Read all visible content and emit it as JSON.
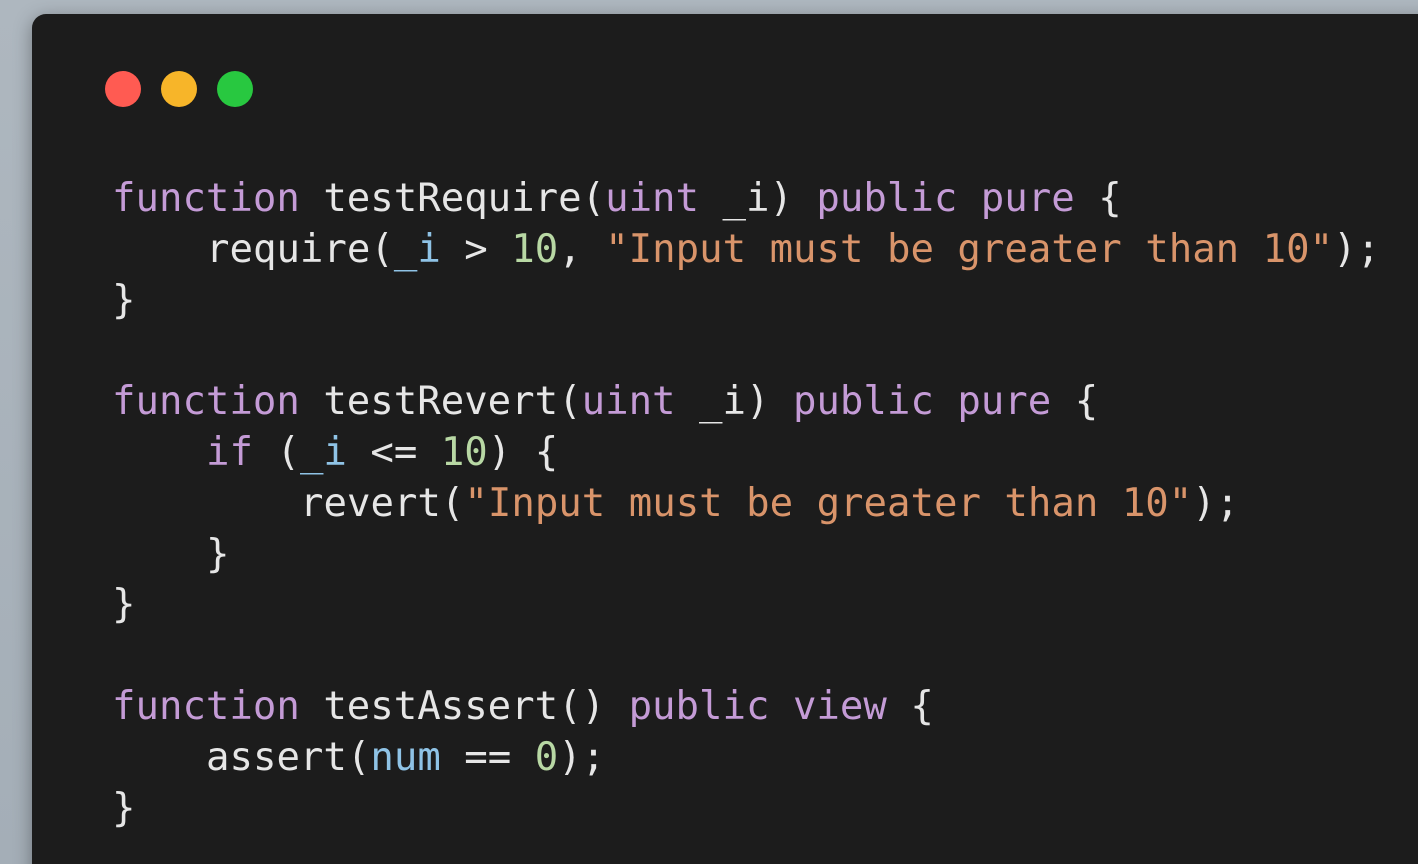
{
  "window": {
    "controls": [
      {
        "name": "close",
        "color": "#ff5b52"
      },
      {
        "name": "minimize",
        "color": "#f7b529"
      },
      {
        "name": "maximize",
        "color": "#28c840"
      }
    ]
  },
  "colors": {
    "background": "#a9b2ba",
    "window": "#1c1c1c",
    "text": "#e6e6e6",
    "keyword": "#c49bd6",
    "string": "#d9946a",
    "number": "#b8d8a4",
    "variable": "#8fc3e6"
  },
  "code": {
    "block1": {
      "kw_function": "function",
      "name_open": " testRequire(",
      "kw_uint": "uint",
      "param_close": " _i) ",
      "kw_public": "public",
      "space": " ",
      "kw_pure": "pure",
      "brace_open": " {",
      "call_open": "require(",
      "var_i": "_i",
      "op": " > ",
      "num": "10",
      "comma": ", ",
      "str": "\"Input must be greater than 10\"",
      "call_close": ");",
      "brace_close": "}"
    },
    "block2": {
      "kw_function": "function",
      "name_open": " testRevert(",
      "kw_uint": "uint",
      "param_close": " _i) ",
      "kw_public": "public",
      "space": " ",
      "kw_pure": "pure",
      "brace_open": " {",
      "kw_if": "if",
      "paren_open": " (",
      "var_i": "_i",
      "op": " <= ",
      "num": "10",
      "paren_close": ") {",
      "call_open": "revert(",
      "str": "\"Input must be greater than 10\"",
      "call_close": ");",
      "if_close": "}",
      "brace_close": "}"
    },
    "block3": {
      "kw_function": "function",
      "name_open": " testAssert() ",
      "kw_public": "public",
      "space": " ",
      "kw_view": "view",
      "brace_open": " {",
      "call_open": "assert(",
      "var_num": "num",
      "op": " == ",
      "num": "0",
      "call_close": ");",
      "brace_close": "}"
    }
  }
}
